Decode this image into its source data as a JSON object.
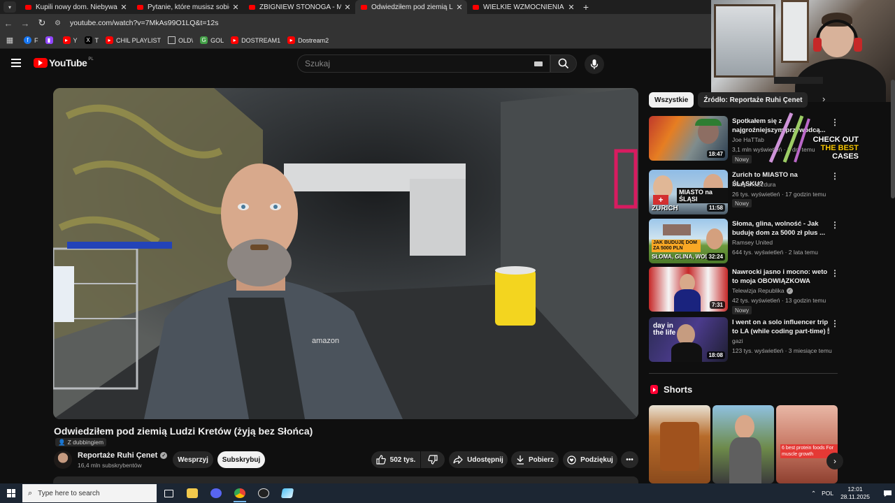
{
  "browser": {
    "tabs": [
      {
        "title": "Kupili nowy dom. Niebywałe, co",
        "active": false
      },
      {
        "title": "Pytanie, które musisz sobie zad",
        "active": false
      },
      {
        "title": "ZBIGNIEW STONOGA - MAM F",
        "active": false
      },
      {
        "title": "Odwiedziłem pod ziemią Ludz",
        "active": true
      },
      {
        "title": "WIELKIE WZMOCNIENIA W WO",
        "active": false
      }
    ],
    "url": "youtube.com/watch?v=7MkAs99O1LQ&t=12s",
    "bookmarks": [
      {
        "label": "F",
        "icon": "facebook-icon",
        "color": "#1877f2"
      },
      {
        "label": "",
        "icon": "twitch-icon",
        "color": "#9146ff"
      },
      {
        "label": "Y",
        "icon": "youtube-icon",
        "color": "#ff0000"
      },
      {
        "label": "T",
        "icon": "x-icon",
        "color": "#000000"
      },
      {
        "label": "CHIL PLAYLIST",
        "icon": "youtube-icon",
        "color": "#ff0000"
      },
      {
        "label": "OLD\\",
        "icon": "folder-icon",
        "color": "#333333"
      },
      {
        "label": "GOL",
        "icon": "g-icon",
        "color": "#43a047"
      },
      {
        "label": "DOSTREAM1",
        "icon": "youtube-icon",
        "color": "#ff0000"
      },
      {
        "label": "Dostream2",
        "icon": "youtube-icon",
        "color": "#ff0000"
      }
    ]
  },
  "youtube": {
    "logo_text": "YouTube",
    "country_code": "PL",
    "search_placeholder": "Szukaj"
  },
  "video": {
    "title": "Odwiedziłem pod ziemią Ludzi Kretów (żyją bez Słońca)",
    "dubbing": "Z dubbingiem",
    "channel": "Reportaże Ruhi Çenet",
    "subscribers": "16,4 mln subskrybentów",
    "support_label": "Wesprzyj",
    "subscribe_label": "Subskrybuj",
    "likes": "502 tys.",
    "share_label": "Udostępnij",
    "download_label": "Pobierz",
    "thanks_label": "Podziękuj",
    "shirt_text": "amazon"
  },
  "sidebar": {
    "chips": [
      "Wszystkie",
      "Źródło: Reportaże Ruhi Çenet"
    ],
    "recommendations": [
      {
        "title": "Spotkałem się z najgroźniejszym przywódcą...",
        "channel": "Joe HaTTab",
        "meta": "3,1 mln wyświetleń · 2 dni temu",
        "duration": "18:47",
        "badge": "Nowy",
        "verified": false
      },
      {
        "title": "Zurich to MIASTO na ŚLĄSKU?",
        "channel": "MaturaToBzdura",
        "meta": "26 tys. wyświetleń · 17 godzin temu",
        "duration": "11:58",
        "badge": "Nowy",
        "verified": false,
        "thumb_text": "MIASTO na ŚLĄSI",
        "thumb_text2": "ZURICH"
      },
      {
        "title": "Słoma, glina, wolność - Jak buduję dom za 5000 zł plus ...",
        "channel": "Ramsey United",
        "meta": "644 tys. wyświetleń · 2 lata temu",
        "duration": "32:24",
        "badge": "",
        "verified": false,
        "thumb_text": "JAK BUDUJĘ DOM ZA 5000 PLN",
        "thumb_text2": "SŁOMA, GLINA, WOL"
      },
      {
        "title": "Nawrocki jasno i mocno: weto to moja OBOWIĄZKOWA obro...",
        "channel": "Telewizja Republika",
        "meta": "42 tys. wyświetleń · 13 godzin temu",
        "duration": "7:31",
        "badge": "Nowy",
        "verified": true
      },
      {
        "title": "I went on a solo influencer trip to LA (while coding part-time) 🕯",
        "channel": "gazi",
        "meta": "123 tys. wyświetleń · 3 miesiące temu",
        "duration": "18:08",
        "badge": "",
        "verified": false,
        "thumb_text": "day in the life"
      }
    ],
    "overlay_ad": {
      "line1": "CHECK OUT",
      "line2": "THE BEST",
      "line3": "CASES"
    },
    "shorts_title": "Shorts",
    "shorts": [
      {
        "label": ""
      },
      {
        "label": ""
      },
      {
        "label": "6 best protein foods For muscle growth"
      }
    ]
  },
  "taskbar": {
    "search_placeholder": "Type here to search",
    "language": "POL",
    "time": "12:01",
    "date": "28.11.2025"
  }
}
